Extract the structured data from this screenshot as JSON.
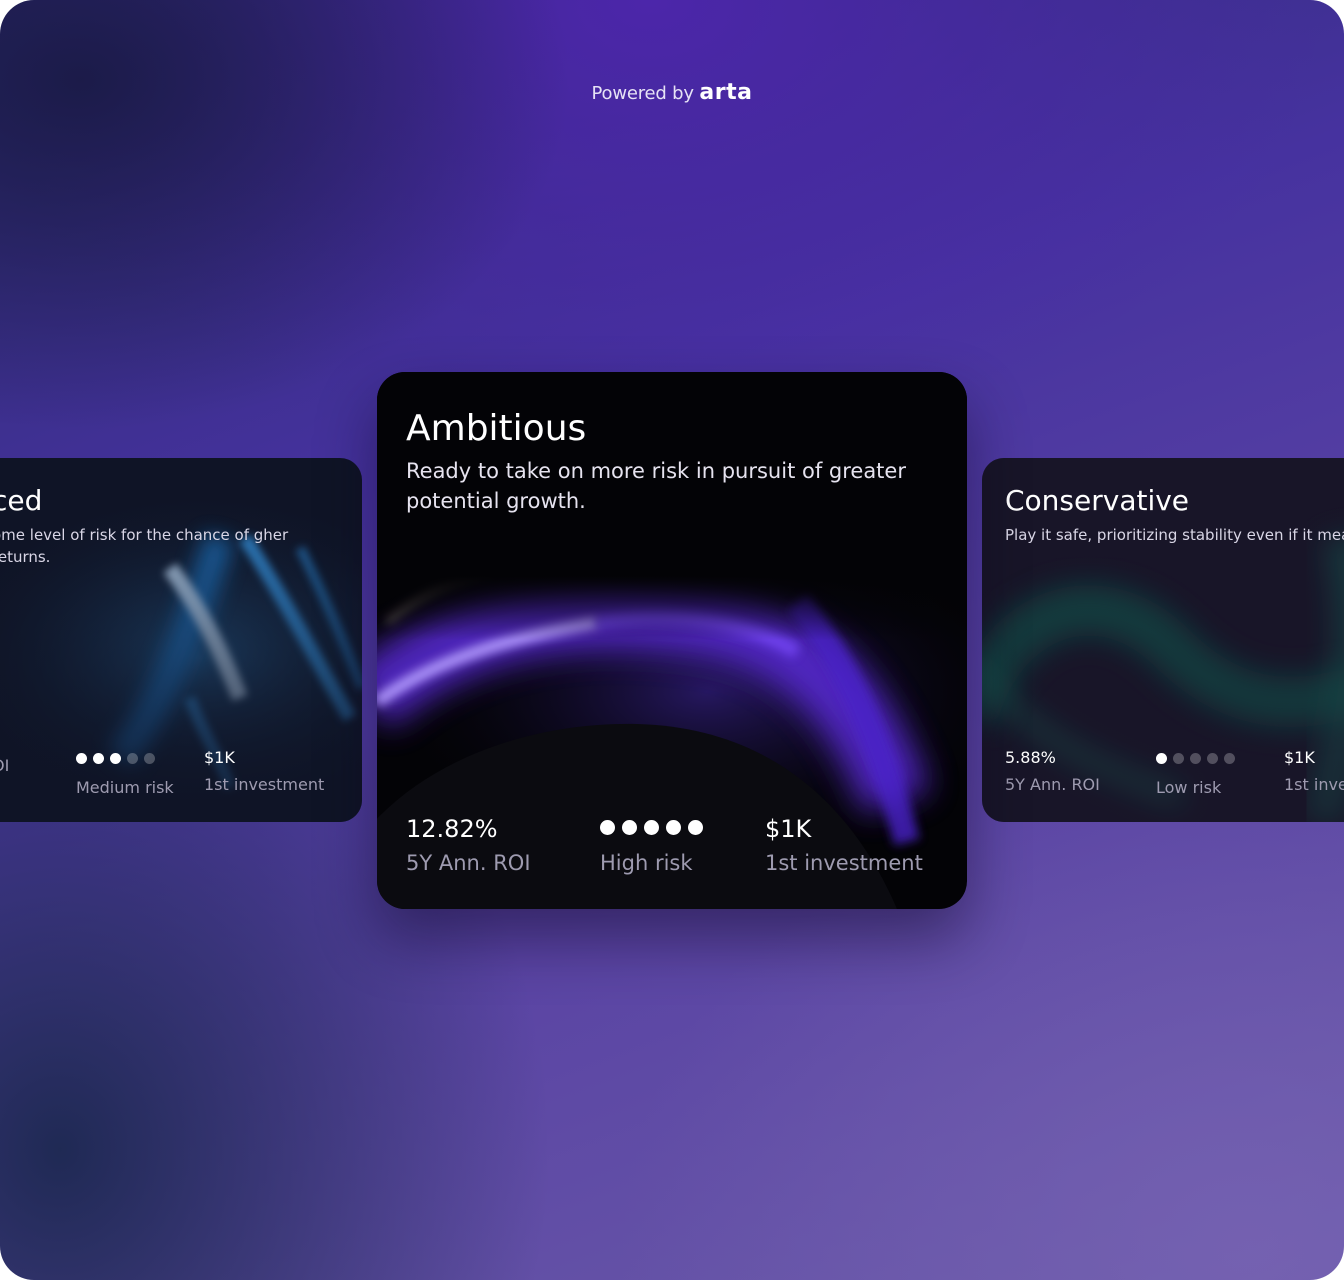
{
  "header": {
    "powered_prefix": "Powered by",
    "brand": "arta"
  },
  "cards": {
    "left": {
      "title": "ced",
      "description": "ome level of risk for the chance of gher returns.",
      "roi_value": "",
      "roi_label": "OI",
      "risk_label": "Medium risk",
      "risk_level_of_5": 3,
      "investment_value": "$1K",
      "investment_label": "1st investment"
    },
    "center": {
      "title": "Ambitious",
      "description": "Ready to take on more risk in pursuit of greater potential growth.",
      "roi_value": "12.82%",
      "roi_label": "5Y Ann. ROI",
      "risk_label": "High risk",
      "risk_level_of_5": 5,
      "investment_value": "$1K",
      "investment_label": "1st investment"
    },
    "right": {
      "title": "Conservative",
      "description": "Play it safe, prioritizing stability even if it mea smaller returns.",
      "roi_value": "5.88%",
      "roi_label": "5Y Ann. ROI",
      "risk_label": "Low risk",
      "risk_level_of_5": 1,
      "investment_value": "$1K",
      "investment_label": "1st inve"
    }
  },
  "colors": {
    "accent_purple": "#7b4dff",
    "accent_blue": "#3aa8ff",
    "accent_green": "#18c58f"
  }
}
